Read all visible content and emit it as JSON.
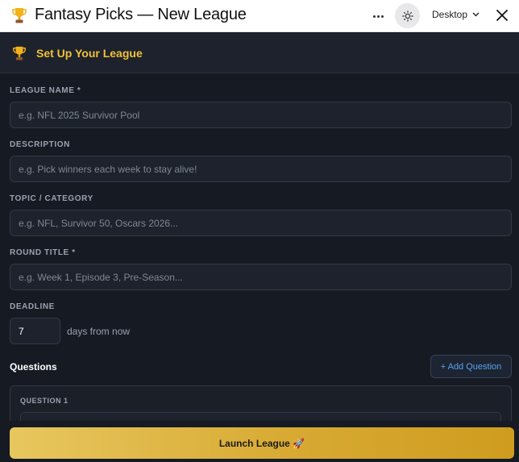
{
  "window": {
    "title": "Fantasy Picks — New League",
    "device_label": "Desktop",
    "icons": [
      "trophy-icon",
      "more-icon",
      "sun-icon",
      "chevron-down-icon",
      "close-icon"
    ]
  },
  "header": {
    "title": "Set Up Your League"
  },
  "form": {
    "league_name": {
      "label": "LEAGUE NAME *",
      "placeholder": "e.g. NFL 2025 Survivor Pool",
      "value": ""
    },
    "description": {
      "label": "DESCRIPTION",
      "placeholder": "e.g. Pick winners each week to stay alive!",
      "value": ""
    },
    "topic": {
      "label": "TOPIC / CATEGORY",
      "placeholder": "e.g. NFL, Survivor 50, Oscars 2026...",
      "value": ""
    },
    "round_title": {
      "label": "ROUND TITLE *",
      "placeholder": "e.g. Week 1, Episode 3, Pre-Season...",
      "value": ""
    },
    "deadline": {
      "label": "DEADLINE",
      "value": "7",
      "suffix": "days from now"
    }
  },
  "questions": {
    "heading": "Questions",
    "add_label": "+ Add Question",
    "items": [
      {
        "label": "QUESTION 1"
      }
    ]
  },
  "footer": {
    "launch_label": "Launch League 🚀"
  },
  "colors": {
    "accent_gold": "#f0c13a",
    "link_blue": "#5aa2f0",
    "background": "#161a22"
  }
}
